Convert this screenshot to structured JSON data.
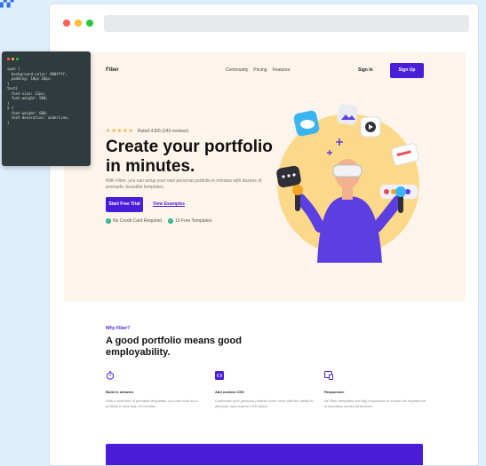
{
  "brand": {
    "name": "Fiber"
  },
  "nav": {
    "links": [
      "Community",
      "Pricing",
      "Features"
    ],
    "signin": "Sign In",
    "signup": "Sign Up"
  },
  "hero": {
    "rating_text": "Rated 4.8/5 (243 reviews)",
    "stars": "★★★★★",
    "title": "Create your portfolio in minutes.",
    "description": "With Fiber, you can setup your own personal portfolio in minutes with dozens of premade, beautiful templates.",
    "cta_primary": "Start Free Trial",
    "cta_secondary": "View Examples",
    "checks": [
      "No Credit Card Required",
      "10 Free Templates"
    ]
  },
  "features": {
    "eyebrow": "Why Fiber?",
    "title": "A good portfolio means good employability.",
    "items": [
      {
        "icon": "stopwatch-icon",
        "title": "Build in minutes",
        "desc": "With a selection of premade templates, you can build out a portfolio in less than 10 minutes."
      },
      {
        "icon": "code-icon",
        "title": "Add custom CSS",
        "desc": "Customize your personal portfolio even more with the ability to add your own custom CSS styles."
      },
      {
        "icon": "devices-icon",
        "title": "Responsive",
        "desc": "All Fiber templates are fully responsive to ensure the experience is seamless across all devices."
      }
    ]
  },
  "code_snippet": {
    "lines": [
      "span {",
      "  background-color: #00ffff;",
      "  padding: 10px 20px;",
      "}",
      "",
      "text{",
      "  font-size: 12px;",
      "  font-weight: 500;",
      "}",
      "",
      "a {",
      "  font-weight: 600;",
      "  text-decoration: underline;",
      "}"
    ]
  },
  "colors": {
    "accent": "#4a1ed8",
    "hero_bg": "#fdf5ec",
    "page_bg": "#dfeefb",
    "star": "#f3a623",
    "check": "#2cb08a"
  }
}
